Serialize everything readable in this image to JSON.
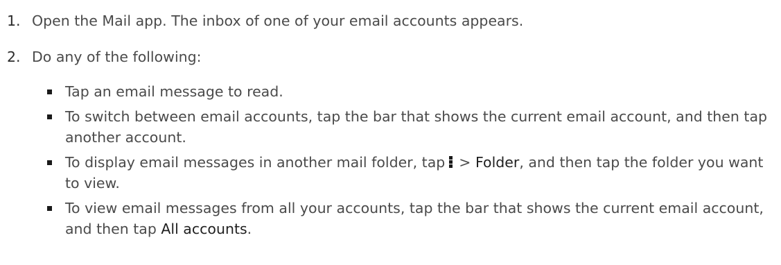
{
  "steps": [
    {
      "number": "1.",
      "text": "Open the Mail app. The inbox of one of your email accounts appears."
    },
    {
      "number": "2.",
      "text": "Do any of the following:"
    }
  ],
  "bullets": [
    {
      "text": "Tap an email message to read."
    },
    {
      "text": "To switch between email accounts, tap the bar that shows the current email account, and then tap another account."
    },
    {
      "before": "To display email messages in another mail folder, tap",
      "icon": "menu-dots-icon",
      "between": "> ",
      "strong": "Folder",
      "after": ", and then tap the folder you want to view."
    },
    {
      "before": "To view email messages from all your accounts, tap the bar that shows the current email account, and then tap ",
      "strong": "All accounts",
      "after": "."
    }
  ]
}
